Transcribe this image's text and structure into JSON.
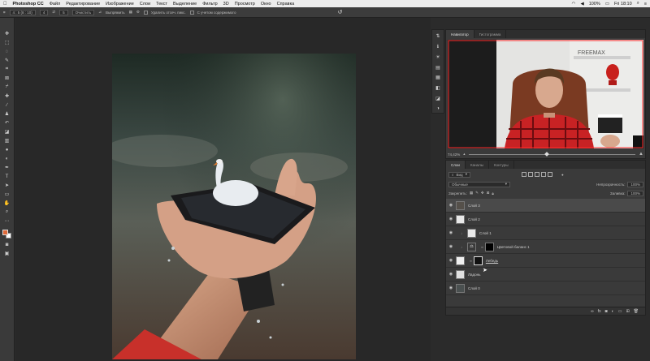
{
  "menubar": {
    "app_name": "Photoshop CC",
    "items": [
      "Файл",
      "Редактирование",
      "Изображение",
      "Слои",
      "Текст",
      "Выделение",
      "Фильтр",
      "3D",
      "Просмотр",
      "Окно",
      "Справка"
    ],
    "battery": "100%",
    "clock": "Fri 18:10"
  },
  "options": {
    "ratio_value": "4 : 5 (8 : 10)",
    "w_value": "4",
    "h_value": "5",
    "clear_label": "Очистить",
    "straighten_label": "Выпрямить",
    "delete_pixels_label": "Удалить отсеч. пикс.",
    "content_aware_label": "С учетом содержимого"
  },
  "navigator": {
    "tabs": [
      "Навигатор",
      "Гистограмма"
    ],
    "zoom": "74,42%"
  },
  "layers": {
    "tabs": [
      "Слои",
      "Каналы",
      "Контуры"
    ],
    "filter_kind": "Вид",
    "blend_mode": "Обычные",
    "opacity_label": "Непрозрачность:",
    "opacity_value": "100%",
    "lock_label": "Закрепить:",
    "fill_label": "Заливка:",
    "fill_value": "100%",
    "list": [
      {
        "name": "Слой 3",
        "thumb": "#55504a"
      },
      {
        "name": "Слой 2",
        "thumb": "#e8e8e8"
      },
      {
        "name": "Слой 1",
        "thumb": "#e8e8e8"
      },
      {
        "name": "Цветовой баланс 1",
        "thumb": "#dcdcdc"
      },
      {
        "name": "Лебедь",
        "thumb": "#f0f0f0"
      },
      {
        "name": "Ладонь",
        "thumb": "#e0e0e0"
      },
      {
        "name": "Слой 0",
        "thumb": "#4a5050"
      }
    ]
  },
  "thumbnail_text": {
    "shirt_print": "FREEMAX"
  },
  "colors": {
    "foreground": "#e06a3a",
    "background": "#ffffff",
    "panel_bg": "#3a3a3a",
    "canvas_bg": "#282828"
  }
}
